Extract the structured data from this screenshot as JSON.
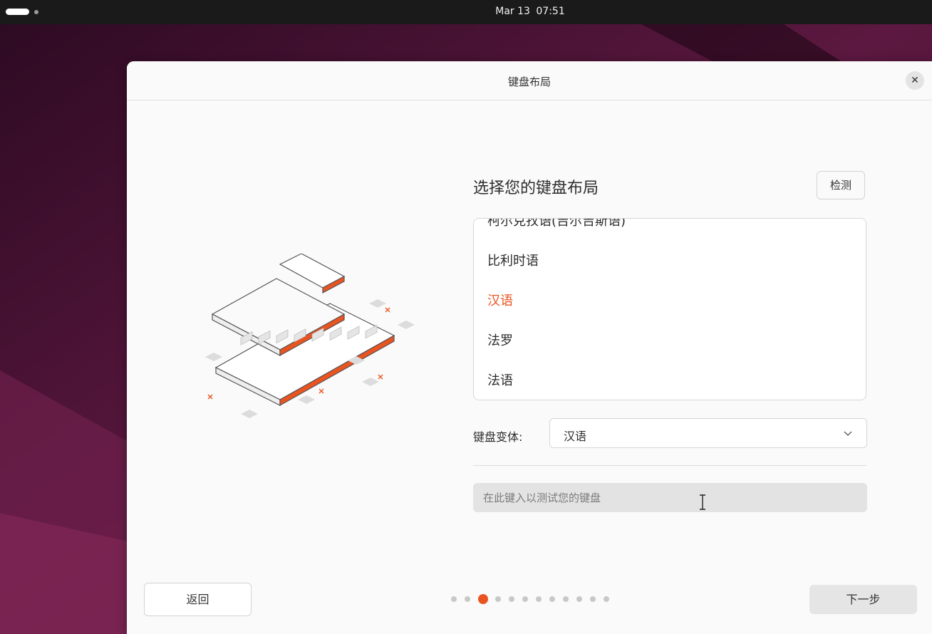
{
  "topbar": {
    "date": "Mar 13",
    "time": "07:51"
  },
  "dialog": {
    "title": "键盘布局",
    "close_icon": "close-icon"
  },
  "keyboard": {
    "heading": "选择您的键盘布局",
    "detect_label": "检测",
    "layouts": [
      {
        "label": "柯尔克孜语(吉尔吉斯语)",
        "selected": false
      },
      {
        "label": "比利时语",
        "selected": false
      },
      {
        "label": "汉语",
        "selected": true
      },
      {
        "label": "法罗",
        "selected": false
      },
      {
        "label": "法语",
        "selected": false
      }
    ],
    "variant_label": "键盘变体:",
    "variant_value": "汉语",
    "test_placeholder": "在此键入以测试您的键盘"
  },
  "footer": {
    "back_label": "返回",
    "next_label": "下一步",
    "pager": {
      "total": 12,
      "current": 3
    }
  },
  "colors": {
    "accent": "#e95420",
    "topbar": "#1a1a1a",
    "wallpaper": "#3b0f2b"
  }
}
